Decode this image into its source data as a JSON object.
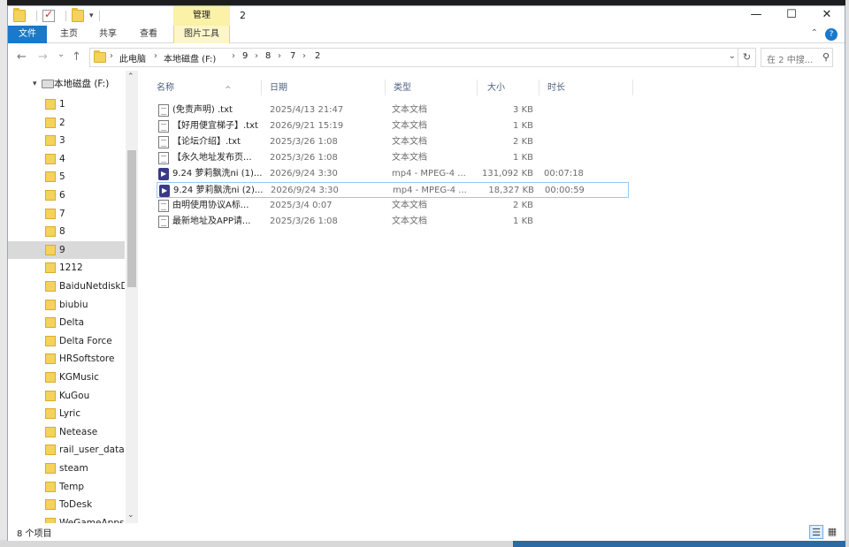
{
  "window": {
    "title": "2",
    "contextual_group": "管理",
    "controls": [
      "—",
      "☐",
      "✕"
    ]
  },
  "ribbon": {
    "file_tab": "文件",
    "tabs": [
      "主页",
      "共享",
      "查看"
    ],
    "contextual_tab": "图片工具"
  },
  "address": {
    "back": "←",
    "forward": "→",
    "recent": "⌄",
    "up": "↑",
    "crumbs": [
      "此电脑",
      "本地磁盘 (F:)",
      "9",
      "8",
      "7",
      "2"
    ],
    "dropdown": "⌄",
    "refresh": "↻",
    "search_placeholder": "在 2 中搜..."
  },
  "nav": {
    "root_label": "本地磁盘 (F:)",
    "items": [
      {
        "label": "1"
      },
      {
        "label": "2"
      },
      {
        "label": "3"
      },
      {
        "label": "4"
      },
      {
        "label": "5"
      },
      {
        "label": "6"
      },
      {
        "label": "7"
      },
      {
        "label": "8"
      },
      {
        "label": "9",
        "selected": true
      },
      {
        "label": "1212"
      },
      {
        "label": "BaiduNetdiskD"
      },
      {
        "label": "biubiu"
      },
      {
        "label": "Delta"
      },
      {
        "label": "Delta Force"
      },
      {
        "label": "HRSoftstore"
      },
      {
        "label": "KGMusic"
      },
      {
        "label": "KuGou"
      },
      {
        "label": "Lyric"
      },
      {
        "label": "Netease"
      },
      {
        "label": "rail_user_data"
      },
      {
        "label": "steam"
      },
      {
        "label": "Temp"
      },
      {
        "label": "ToDesk"
      },
      {
        "label": "WeGameApps"
      }
    ]
  },
  "columns": [
    "名称",
    "日期",
    "类型",
    "大小",
    "时长"
  ],
  "files": [
    {
      "name": "(免责声明) .txt",
      "date": "2025/4/13 21:47",
      "type": "文本文档",
      "size": "3 KB",
      "duration": "",
      "icon": "text-file",
      "selected": false
    },
    {
      "name": "【好用便宜梯子】.txt",
      "date": "2026/9/21 15:19",
      "type": "文本文档",
      "size": "1 KB",
      "duration": "",
      "icon": "text-file",
      "selected": false
    },
    {
      "name": "【论坛介绍】.txt",
      "date": "2025/3/26 1:08",
      "type": "文本文档",
      "size": "2 KB",
      "duration": "",
      "icon": "text-file",
      "selected": false
    },
    {
      "name": "【永久地址发布页...",
      "date": "2025/3/26 1:08",
      "type": "文本文档",
      "size": "1 KB",
      "duration": "",
      "icon": "text-file",
      "selected": false
    },
    {
      "name": "9.24 萝莉飘洗ni (1)...",
      "date": "2026/9/24 3:30",
      "type": "mp4 - MPEG-4 ...",
      "size": "131,092 KB",
      "duration": "00:07:18",
      "icon": "video-file",
      "selected": false
    },
    {
      "name": "9.24 萝莉飘洗ni (2)...",
      "date": "2026/9/24 3:30",
      "type": "mp4 - MPEG-4 ...",
      "size": "18,327 KB",
      "duration": "00:00:59",
      "icon": "video-file",
      "selected": true
    },
    {
      "name": "由明使用协议A标...",
      "date": "2025/3/4 0:07",
      "type": "文本文档",
      "size": "2 KB",
      "duration": "",
      "icon": "text-file",
      "selected": false
    },
    {
      "name": "最新地址及APP请...",
      "date": "2025/3/26 1:08",
      "type": "文本文档",
      "size": "1 KB",
      "duration": "",
      "icon": "text-file",
      "selected": false
    }
  ],
  "status": {
    "count": "8 个项目"
  },
  "colors": {
    "file_tab": "#1979ca",
    "context_tab": "#fbf1a7",
    "selection": "#99c9ef",
    "header_text": "#4d6082"
  }
}
